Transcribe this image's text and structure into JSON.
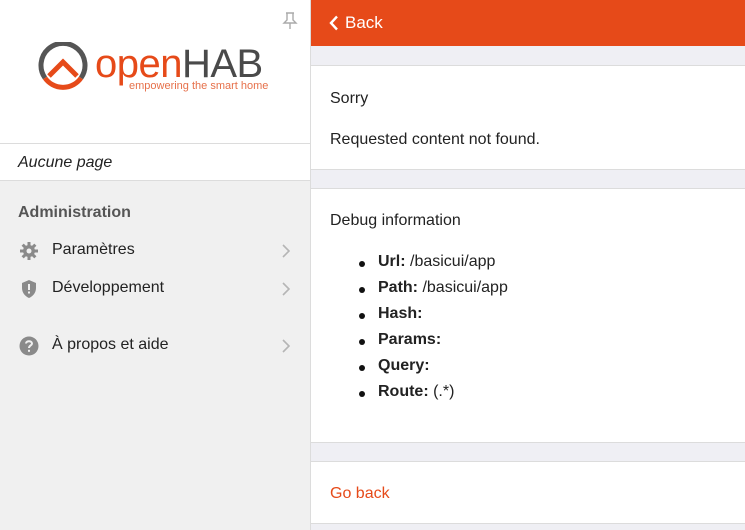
{
  "sidebar": {
    "logo": {
      "text_open": "open",
      "text_hab": "HAB",
      "tagline": "empowering the smart home"
    },
    "current_page": "Aucune page",
    "section_title": "Administration",
    "items": [
      {
        "label": "Paramètres",
        "icon": "gear-icon"
      },
      {
        "label": "Développement",
        "icon": "shield-icon"
      },
      {
        "label": "À propos et aide",
        "icon": "help-icon"
      }
    ]
  },
  "navbar": {
    "back_label": "Back"
  },
  "error": {
    "title": "Sorry",
    "message": "Requested content not found."
  },
  "debug": {
    "title": "Debug information",
    "items": [
      {
        "key": "Url:",
        "value": " /basicui/app"
      },
      {
        "key": "Path:",
        "value": " /basicui/app"
      },
      {
        "key": "Hash:",
        "value": ""
      },
      {
        "key": "Params:",
        "value": ""
      },
      {
        "key": "Query:",
        "value": ""
      },
      {
        "key": "Route:",
        "value": " (.*)"
      }
    ]
  },
  "footer": {
    "go_back_label": "Go back"
  },
  "colors": {
    "accent": "#e64a19",
    "sidebar_bg": "#f0f0f0",
    "page_bg": "#efeff4"
  }
}
